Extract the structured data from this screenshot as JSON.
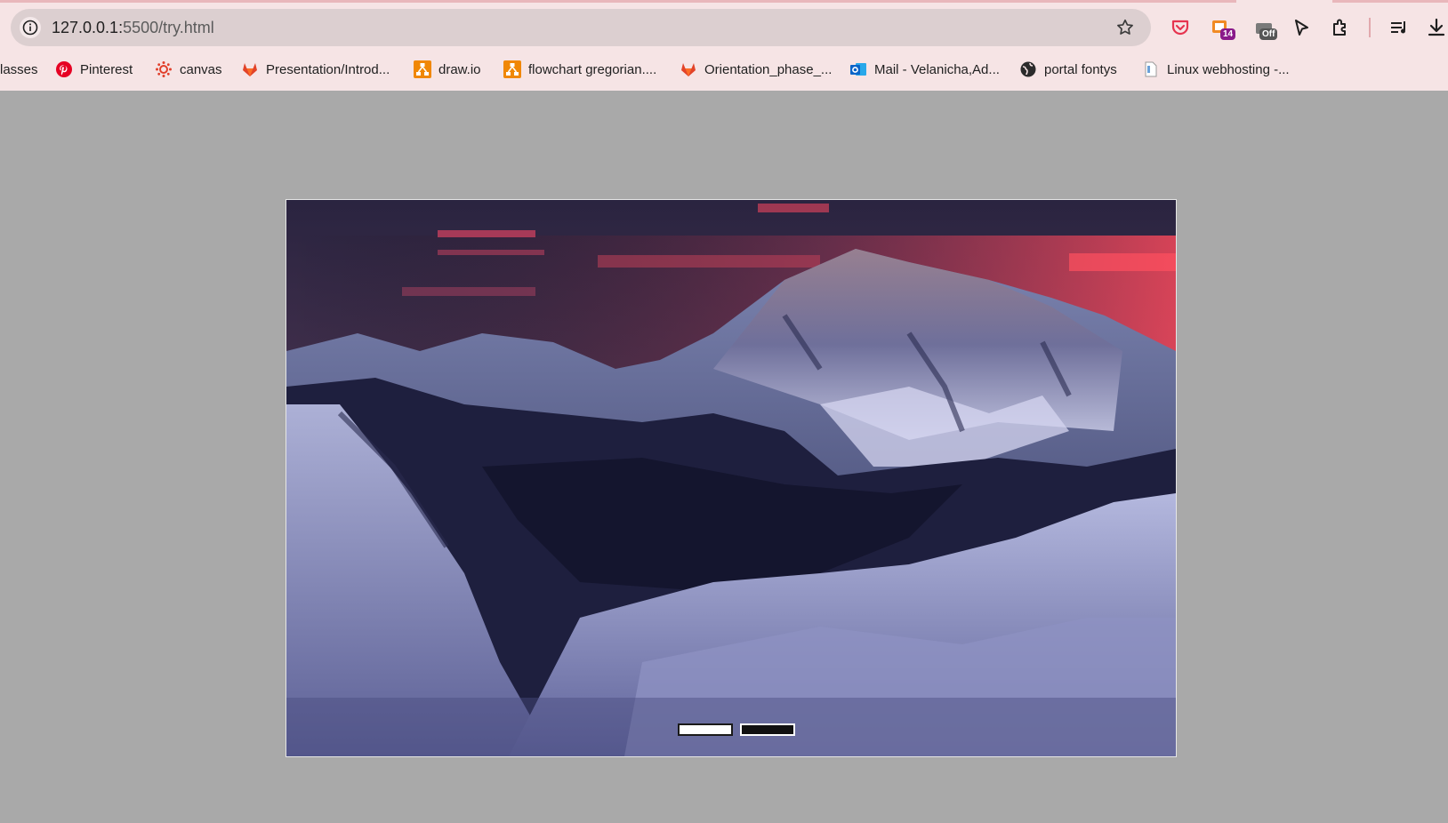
{
  "browser": {
    "address_bar": {
      "host": "127.0.0.1:",
      "path": "5500/try.html"
    },
    "extensions": [
      {
        "icon": "pocket-icon"
      },
      {
        "icon": "tab-counter-icon",
        "badge": "14"
      },
      {
        "icon": "toggle-off-icon",
        "badge": "Off"
      },
      {
        "icon": "cursor-icon"
      },
      {
        "icon": "extensions-puzzle-icon"
      },
      {
        "icon": "reading-list-icon"
      },
      {
        "icon": "download-icon"
      }
    ],
    "colors": {
      "pocket": "#e6344f",
      "counter_badge": "#8a1a8a",
      "off_badge": "#555555",
      "pinterest": "#e60023",
      "gitlab": "#e24329",
      "drawio": "#f08705",
      "outlook": "#0a64c8"
    }
  },
  "bookmarks": [
    {
      "label": "lasses",
      "icon": "none"
    },
    {
      "label": "Pinterest",
      "icon": "pinterest-icon"
    },
    {
      "label": "canvas",
      "icon": "canvas-icon"
    },
    {
      "label": "Presentation/Introd...",
      "icon": "gitlab-icon"
    },
    {
      "label": "draw.io",
      "icon": "drawio-icon"
    },
    {
      "label": "flowchart gregorian....",
      "icon": "drawio-icon"
    },
    {
      "label": "Orientation_phase_...",
      "icon": "gitlab-icon"
    },
    {
      "label": "Mail - Velanicha,Ad...",
      "icon": "outlook-icon"
    },
    {
      "label": "portal fontys",
      "icon": "globe-icon"
    },
    {
      "label": "Linux webhosting -...",
      "icon": "page-icon"
    }
  ],
  "slideshow": {
    "image": "snowy-mountain-range-at-dusk",
    "dots": [
      {
        "state": "active"
      },
      {
        "state": "inactive"
      }
    ]
  }
}
